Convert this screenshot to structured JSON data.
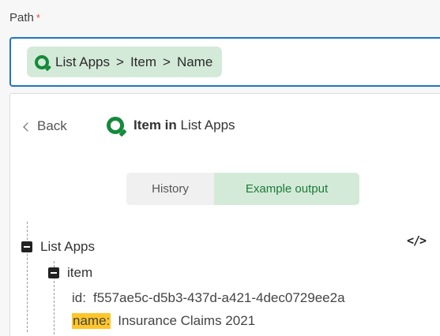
{
  "path_field": {
    "label": "Path",
    "required_mark": "*",
    "chip": {
      "icon": "qlik-logo-icon",
      "segments": [
        "List Apps",
        "Item",
        "Name"
      ],
      "separator": ">"
    }
  },
  "panel": {
    "back_label": "Back",
    "title": {
      "icon": "qlik-logo-icon",
      "strong": "Item in",
      "rest": "List Apps"
    },
    "segmented": {
      "options": [
        "History",
        "Example output"
      ],
      "selected": "Example output"
    },
    "tree": {
      "root_label": "List Apps",
      "code_icon": "code-icon",
      "child_label": "item",
      "fields": [
        {
          "key": "id:",
          "value": "f557ae5c-d5b3-437d-a421-4dec0729ee2a",
          "highlighted": false
        },
        {
          "key": "name:",
          "value": "Insurance Claims 2021",
          "highlighted": true
        }
      ]
    }
  },
  "colors": {
    "focus_border": "#1e74c6",
    "chip_bg": "#d4ead8",
    "brand_green": "#148a3a",
    "highlight": "#ffc62a",
    "required": "#e04e39"
  }
}
